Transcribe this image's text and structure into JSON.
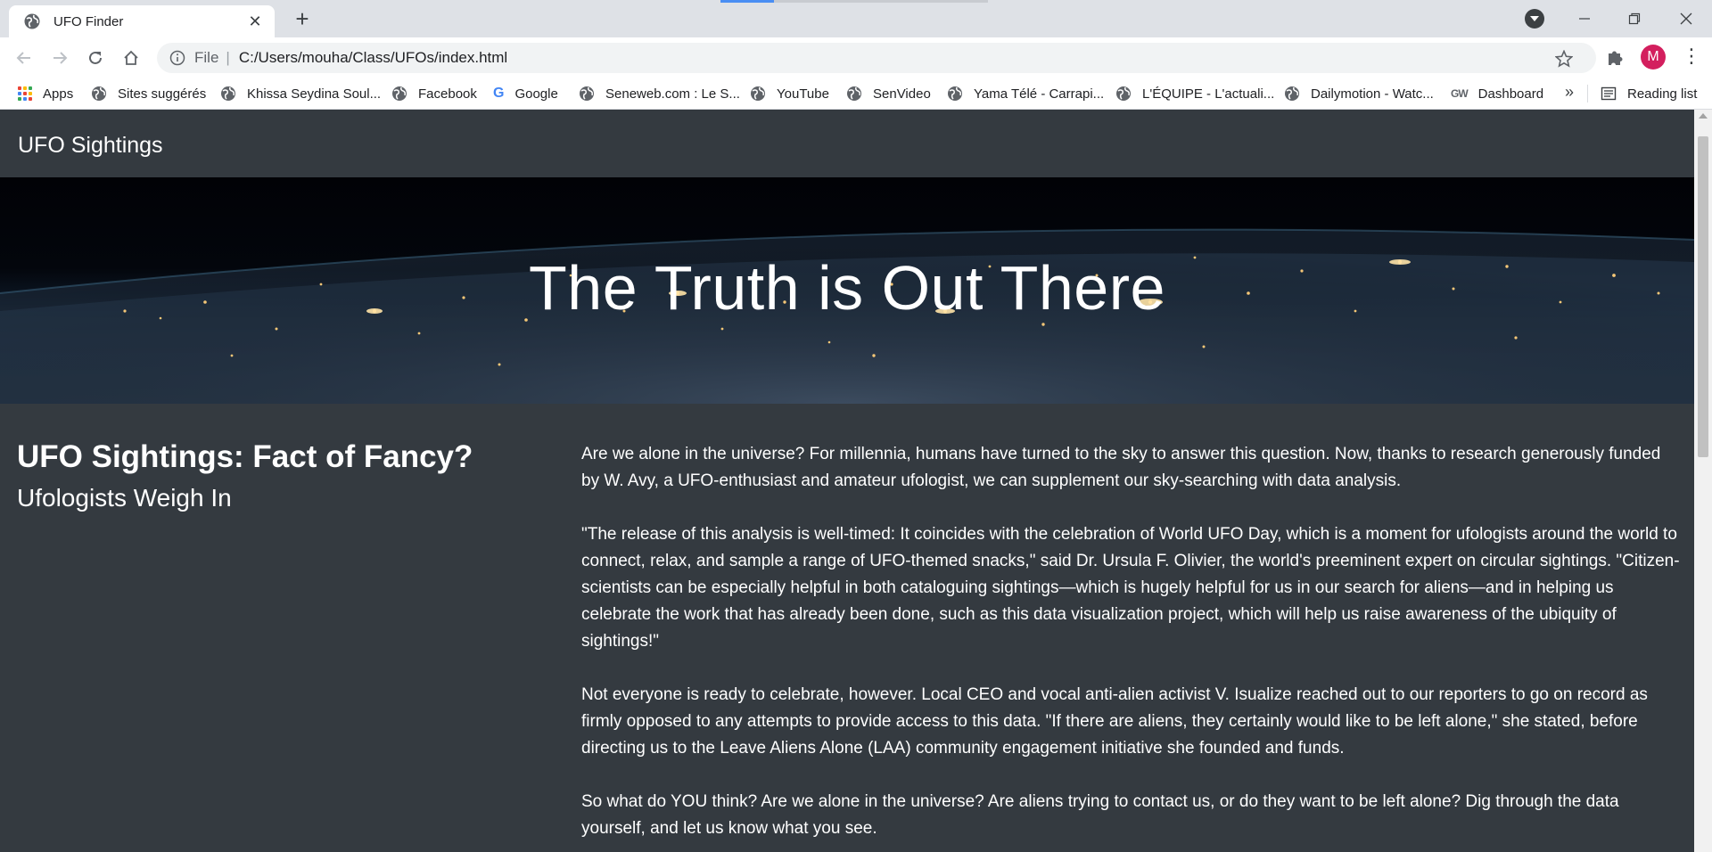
{
  "browser": {
    "tab_title": "UFO Finder",
    "address_scheme": "File",
    "address_url": "C:/Users/mouha/Class/UFOs/index.html",
    "avatar_letter": "M",
    "bookmarks": [
      {
        "label": "Apps",
        "icon": "apps-grid-icon"
      },
      {
        "label": "Sites suggérés",
        "icon": "globe-icon"
      },
      {
        "label": "Khissa Seydina Soul...",
        "icon": "globe-icon"
      },
      {
        "label": "Facebook",
        "icon": "globe-icon"
      },
      {
        "label": "Google",
        "icon": "google-icon"
      },
      {
        "label": "Seneweb.com : Le S...",
        "icon": "globe-icon"
      },
      {
        "label": "YouTube",
        "icon": "globe-icon"
      },
      {
        "label": "SenVideo",
        "icon": "globe-icon"
      },
      {
        "label": "Yama Télé - Carrapi...",
        "icon": "globe-icon"
      },
      {
        "label": "L'ÉQUIPE - L'actuali...",
        "icon": "globe-icon"
      },
      {
        "label": "Dailymotion - Watc...",
        "icon": "globe-icon"
      },
      {
        "label": "Dashboard",
        "icon": "gw-icon",
        "icon_text": "GW"
      }
    ],
    "reading_list": "Reading list",
    "overflow": "»"
  },
  "page": {
    "brand": "UFO Sightings",
    "hero_title": "The Truth is Out There",
    "side_title": "UFO Sightings: Fact of Fancy?",
    "side_subtitle": "Ufologists Weigh In",
    "paragraphs": [
      "Are we alone in the universe? For millennia, humans have turned to the sky to answer this question. Now, thanks to research generously funded by W. Avy, a UFO-enthusiast and amateur ufologist, we can supplement our sky-searching with data analysis.",
      "\"The release of this analysis is well-timed: It coincides with the celebration of World UFO Day, which is a moment for ufologists around the world to connect, relax, and sample a range of UFO-themed snacks,\" said Dr. Ursula F. Olivier, the world's preeminent expert on circular sightings. \"Citizen-scientists can be especially helpful in both cataloguing sightings—which is hugely helpful for us in our search for aliens—and in helping us celebrate the work that has already been done, such as this data visualization project, which will help us raise awareness of the ubiquity of sightings!\"",
      "Not everyone is ready to celebrate, however. Local CEO and vocal anti-alien activist V. Isualize reached out to our reporters to go on record as firmly opposed to any attempts to provide access to this data. \"If there are aliens, they certainly would like to be left alone,\" she stated, before directing us to the Leave Aliens Alone (LAA) community engagement initiative she founded and funds.",
      "So what do YOU think? Are we alone in the universe? Are aliens trying to contact us, or do they want to be left alone? Dig through the data yourself, and let us know what you see."
    ]
  },
  "colors": {
    "page_bg": "#343a40",
    "avatar": "#d31f5e",
    "tabstrip": "#dee1e6"
  }
}
